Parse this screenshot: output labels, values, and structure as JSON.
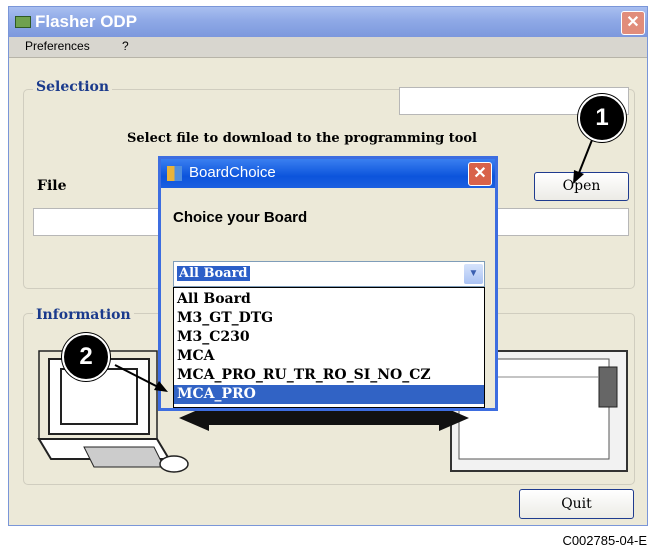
{
  "window": {
    "title": "Flasher ODP",
    "close_glyph": "✕"
  },
  "menu": [
    "Preferences",
    "?"
  ],
  "selection": {
    "label": "Selection",
    "instruction": "Select file to download to the programming tool",
    "file_label": "File",
    "open_button": "Open"
  },
  "information": {
    "label": "Information"
  },
  "quit_button": "Quit",
  "dialog": {
    "title": "BoardChoice",
    "close_glyph": "✕",
    "heading": "Choice your Board",
    "selected_value": "All Board",
    "options": [
      "All Board",
      "M3_GT_DTG",
      "M3_C230",
      "MCA",
      "MCA_PRO_RU_TR_RO_SI_NO_CZ",
      "MCA_PRO"
    ],
    "highlighted_option": "MCA_PRO"
  },
  "callouts": [
    "1",
    "2"
  ],
  "caption": "C002785-04-E",
  "colors": {
    "title_bar": "#8fa9e6",
    "dialog_title_bar": "#0c54dc",
    "selection_highlight": "#3163c5",
    "group_label": "#1a3a8c"
  }
}
